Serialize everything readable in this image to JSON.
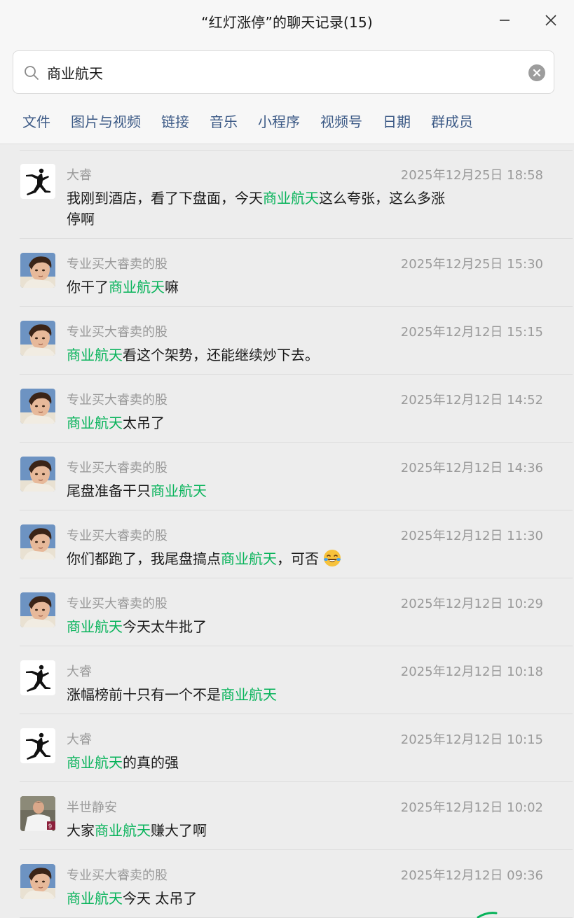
{
  "window": {
    "title": "“红灯涨停”的聊天记录(15)",
    "minimize_icon": "minimize-icon",
    "close_icon": "close-icon"
  },
  "search": {
    "value": "商业航天",
    "placeholder": "",
    "icon": "search-icon",
    "clear_icon": "clear-icon"
  },
  "tabs": [
    "文件",
    "图片与视频",
    "链接",
    "音乐",
    "小程序",
    "视频号",
    "日期",
    "群成员"
  ],
  "colors": {
    "highlight": "#07b35a",
    "tab_text": "#3c5a86",
    "meta_text": "#9a9a9a",
    "background": "#ededed"
  },
  "messages": [
    {
      "sender": "大睿",
      "time": "2025年12月25日 18:58",
      "avatar": "jordan-logo-avatar",
      "pre": "我刚到酒店，看了下盘面，今天",
      "keyword": "商业航天",
      "post": "这么夸张，这么多涨停啊"
    },
    {
      "sender": "专业买大睿卖的股",
      "time": "2025年12月25日 15:30",
      "avatar": "boy-portrait-avatar",
      "pre": "你干了",
      "keyword": "商业航天",
      "post": "嘛"
    },
    {
      "sender": "专业买大睿卖的股",
      "time": "2025年12月12日 15:15",
      "avatar": "boy-portrait-avatar",
      "pre": "",
      "keyword": "商业航天",
      "post": "看这个架势，还能继续炒下去。"
    },
    {
      "sender": "专业买大睿卖的股",
      "time": "2025年12月12日 14:52",
      "avatar": "boy-portrait-avatar",
      "pre": "",
      "keyword": "商业航天",
      "post": "太吊了"
    },
    {
      "sender": "专业买大睿卖的股",
      "time": "2025年12月12日 14:36",
      "avatar": "boy-portrait-avatar",
      "pre": "尾盘准备干只",
      "keyword": "商业航天",
      "post": ""
    },
    {
      "sender": "专业买大睿卖的股",
      "time": "2025年12月12日 11:30",
      "avatar": "boy-portrait-avatar",
      "pre": "你们都跑了，我尾盘搞点",
      "keyword": "商业航天",
      "post": "，可否",
      "emoji": "laughing-crying-emoji"
    },
    {
      "sender": "专业买大睿卖的股",
      "time": "2025年12月12日 10:29",
      "avatar": "boy-portrait-avatar",
      "pre": "",
      "keyword": "商业航天",
      "post": "今天太牛批了"
    },
    {
      "sender": "大睿",
      "time": "2025年12月12日 10:18",
      "avatar": "jordan-logo-avatar",
      "pre": "涨幅榜前十只有一个不是",
      "keyword": "商业航天",
      "post": ""
    },
    {
      "sender": "大睿",
      "time": "2025年12月12日 10:15",
      "avatar": "jordan-logo-avatar",
      "pre": "",
      "keyword": "商业航天",
      "post": "的真的强"
    },
    {
      "sender": "半世静安",
      "time": "2025年12月12日 10:02",
      "avatar": "football-player-avatar",
      "pre": "大家",
      "keyword": "商业航天",
      "post": "赚大了啊"
    },
    {
      "sender": "专业买大睿卖的股",
      "time": "2025年12月12日 09:36",
      "avatar": "boy-portrait-avatar",
      "pre": "",
      "keyword": "商业航天",
      "post": "今天 太吊了"
    }
  ]
}
